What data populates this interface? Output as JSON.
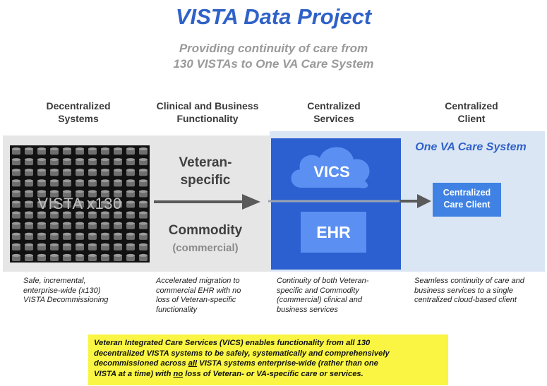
{
  "title": "VISTA Data Project",
  "subtitle_line1": "Providing continuity of care from",
  "subtitle_line2": "130 VISTAs to One VA Care System",
  "columns": [
    {
      "line1": "Decentralized",
      "line2": "Systems"
    },
    {
      "line1": "Clinical and Business",
      "line2": "Functionality"
    },
    {
      "line1": "Centralized",
      "line2": "Services"
    },
    {
      "line1": "Centralized",
      "line2": "Client"
    }
  ],
  "vista_label": "VISTA x130",
  "veteran_line1": "Veteran-",
  "veteran_line2": "specific",
  "commodity": "Commodity",
  "commercial": "(commercial)",
  "one_va": "One VA Care System",
  "vics": "VICS",
  "ehr": "EHR",
  "client_line1": "Centralized",
  "client_line2": "Care Client",
  "descriptions": [
    [
      "Safe, incremental,",
      "enterprise-wide (x130)",
      "VISTA Decommissioning"
    ],
    [
      "Accelerated migration to",
      "commercial EHR with no",
      "loss of Veteran-specific",
      "functionality"
    ],
    [
      "Continuity of  both  Veteran-",
      "specific and Commodity",
      "(commercial) clinical and",
      "business services"
    ],
    [
      "Seamless continuity of care and",
      "business services to a single",
      "centralized cloud-based client"
    ]
  ],
  "note": {
    "line1": "Veteran Integrated Care Services (VICS)  enables functionality from all 130",
    "line2": "decentralized VISTA  systems to be  safely, systematically and comprehensively",
    "line3_a": "decommissioned across ",
    "line3_u": "all",
    "line3_b": " VISTA systems  enterprise-wide (rather than one",
    "line4_a": "VISTA at a time) with ",
    "line4_u": "no",
    "line4_b": " loss of Veteran- or VA-specific care or services."
  },
  "colors": {
    "title_blue": "#2f62c8",
    "panel_blue": "#2c5fd0",
    "light_band": "#dbe6f5",
    "gray_band": "#e6e6e6",
    "note_yellow": "#f9f542"
  }
}
